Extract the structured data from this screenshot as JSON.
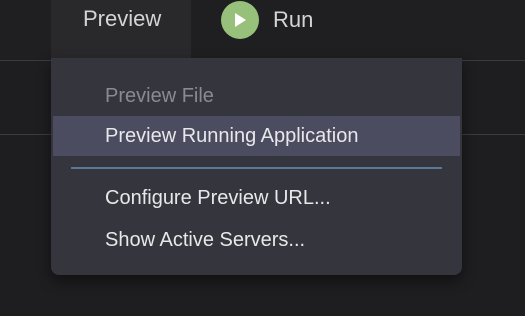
{
  "toolbar": {
    "preview_label": "Preview",
    "run_label": "Run",
    "run_icon": "play-icon",
    "run_icon_color": "#97c17a"
  },
  "menu": {
    "items": [
      {
        "label": "Preview File",
        "state": "disabled"
      },
      {
        "label": "Preview Running Application",
        "state": "highlighted"
      },
      {
        "label": "Configure Preview URL...",
        "state": "normal"
      },
      {
        "label": "Show Active Servers...",
        "state": "normal"
      }
    ],
    "highlight_color": "#4b4c60",
    "separator_color": "#5b7796"
  }
}
